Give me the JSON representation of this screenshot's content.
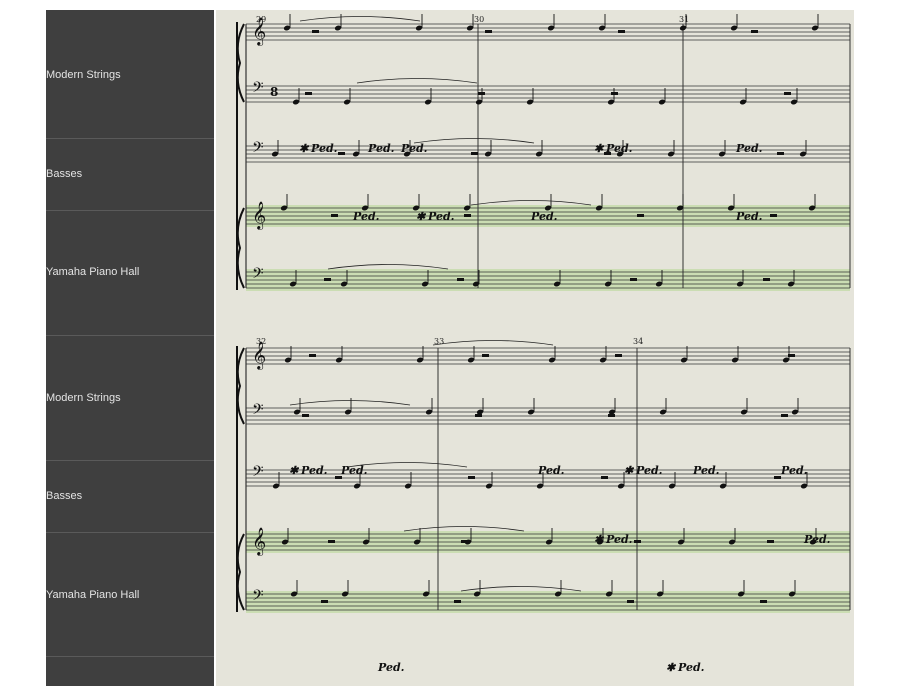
{
  "sidebar": {
    "tracks": [
      {
        "label": "Modern Strings"
      },
      {
        "label": "Basses"
      },
      {
        "label": "Yamaha Piano Hall"
      },
      {
        "label": "Modern Strings"
      },
      {
        "label": "Basses"
      },
      {
        "label": "Yamaha Piano Hall"
      }
    ]
  },
  "score": {
    "systems": [
      {
        "measure_numbers": [
          "29",
          "30",
          "31"
        ]
      },
      {
        "measure_numbers": [
          "32",
          "33",
          "34"
        ]
      }
    ],
    "pedal_mark": "Ped.",
    "pedal_release": "✱",
    "clefs": {
      "treble": "𝄞",
      "bass": "𝄢"
    },
    "time_signature": "8"
  },
  "colors": {
    "sidebar_bg": "#3f3f3f",
    "score_bg": "#e5e4da",
    "piano_highlight": "#c7dcab",
    "staff_line": "#333333"
  }
}
